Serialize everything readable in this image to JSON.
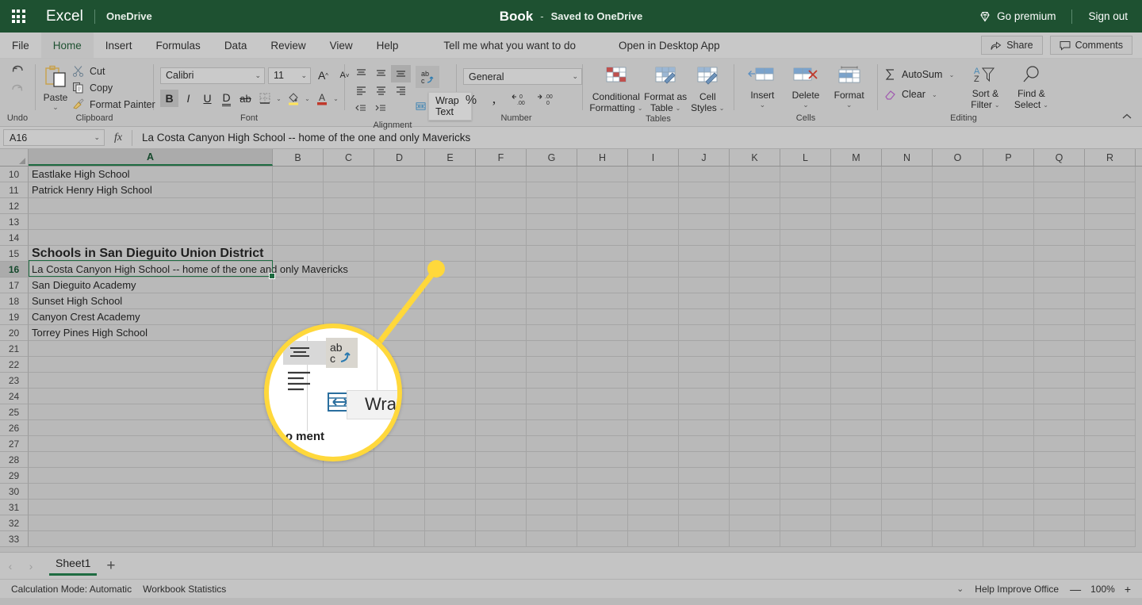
{
  "titlebar": {
    "waffle_icon": "app-launcher-icon",
    "brand": "Excel",
    "location": "OneDrive",
    "doc_name": "Book",
    "doc_dash": "-",
    "doc_state": "Saved to OneDrive",
    "premium_label": "Go premium",
    "premium_icon": "diamond-icon",
    "signout_label": "Sign out",
    "bg_color": "#1e5131"
  },
  "tabs": [
    {
      "label": "File",
      "active": false
    },
    {
      "label": "Home",
      "active": true
    },
    {
      "label": "Insert",
      "active": false
    },
    {
      "label": "Formulas",
      "active": false
    },
    {
      "label": "Data",
      "active": false
    },
    {
      "label": "Review",
      "active": false
    },
    {
      "label": "View",
      "active": false
    },
    {
      "label": "Help",
      "active": false
    },
    {
      "label": "Tell me what you want to do",
      "active": false
    },
    {
      "label": "Open in Desktop App",
      "active": false
    }
  ],
  "tabbar_right": {
    "share_label": "Share",
    "share_icon": "share-icon",
    "comments_label": "Comments",
    "comments_icon": "comment-icon"
  },
  "ribbon": {
    "undo": {
      "group_label": "Undo",
      "undo_icon": "undo-arrow-icon",
      "redo_icon": "redo-arrow-icon"
    },
    "clipboard": {
      "group_label": "Clipboard",
      "paste_label": "Paste",
      "paste_icon": "clipboard-icon",
      "cut_label": "Cut",
      "cut_icon": "scissors-icon",
      "copy_label": "Copy",
      "copy_icon": "copy-icon",
      "format_painter_label": "Format Painter",
      "format_painter_icon": "paintbrush-icon"
    },
    "font": {
      "group_label": "Font",
      "font_family": "Calibri",
      "font_size": "11",
      "grow_font_icon": "grow-font-icon",
      "shrink_font_icon": "shrink-font-icon",
      "bold": "B",
      "italic": "I",
      "underline": "U",
      "double_underline": "D",
      "strikethrough": "ab",
      "borders_icon": "borders-icon",
      "fill_color_icon": "fill-color-icon",
      "font_color_icon": "font-color-icon",
      "bold_active": true
    },
    "alignment": {
      "group_label": "Alignment",
      "top_align_icon": "align-top-icon",
      "middle_align_icon": "align-middle-icon",
      "bottom_align_icon": "align-bottom-icon",
      "align_left_icon": "align-left-icon",
      "align_center_icon": "align-center-icon",
      "align_right_icon": "align-right-icon",
      "decrease_indent_icon": "decrease-indent-icon",
      "increase_indent_icon": "increase-indent-icon",
      "text_orientation_icon": "text-orientation-icon",
      "wrap_text_icon": "wrap-text-icon",
      "wrap_text_tooltip": "Wrap Text"
    },
    "number": {
      "group_label": "Number",
      "format_value": "General",
      "percent_icon": "percent-style-icon",
      "comma_icon": "comma-style-icon",
      "increase_decimal_icon": "increase-decimal-icon",
      "decrease_decimal_icon": "decrease-decimal-icon"
    },
    "tables": {
      "group_label": "Tables",
      "conditional_formatting": "Conditional Formatting",
      "format_as_table": "Format as Table",
      "cell_styles": "Cell Styles"
    },
    "cells": {
      "group_label": "Cells",
      "insert_label": "Insert",
      "delete_label": "Delete",
      "format_label": "Format"
    },
    "editing": {
      "group_label": "Editing",
      "autosum_label": "AutoSum",
      "autosum_icon": "sigma-icon",
      "clear_label": "Clear",
      "clear_icon": "eraser-icon",
      "sort_filter_label": "Sort & Filter",
      "sort_filter_icon": "sort-filter-icon",
      "find_select_label": "Find & Select",
      "find_select_icon": "magnifier-icon"
    },
    "collapse_icon": "chevron-up-icon"
  },
  "formula_bar": {
    "name_box_value": "A16",
    "name_box_caret": "chevron-down-icon",
    "fx_label": "fx",
    "formula_value": "La Costa Canyon High School -- home of the one and only Mavericks"
  },
  "grid": {
    "columns": [
      "A",
      "B",
      "C",
      "D",
      "E",
      "F",
      "G",
      "H",
      "I",
      "J",
      "K",
      "L",
      "M",
      "N",
      "O",
      "P",
      "Q",
      "R"
    ],
    "selected_column": "A",
    "selected_row": 16,
    "selected_cell": "A16",
    "rows": [
      {
        "num": 10,
        "a": "Eastlake High School",
        "style": "normal"
      },
      {
        "num": 11,
        "a": "Patrick Henry High School",
        "style": "normal"
      },
      {
        "num": 12,
        "a": "",
        "style": "normal"
      },
      {
        "num": 13,
        "a": "",
        "style": "normal"
      },
      {
        "num": 14,
        "a": "",
        "style": "normal"
      },
      {
        "num": 15,
        "a": "Schools in San Dieguito Union District",
        "style": "heading"
      },
      {
        "num": 16,
        "a": "La Costa Canyon High School -- home of the one and only Mavericks",
        "style": "selected"
      },
      {
        "num": 17,
        "a": "San Dieguito Academy",
        "style": "normal"
      },
      {
        "num": 18,
        "a": "Sunset High School",
        "style": "normal"
      },
      {
        "num": 19,
        "a": "Canyon Crest Academy",
        "style": "normal"
      },
      {
        "num": 20,
        "a": "Torrey Pines High School",
        "style": "normal"
      },
      {
        "num": 21,
        "a": "",
        "style": "normal"
      },
      {
        "num": 22,
        "a": "",
        "style": "normal"
      },
      {
        "num": 23,
        "a": "",
        "style": "normal"
      },
      {
        "num": 24,
        "a": "",
        "style": "normal"
      },
      {
        "num": 25,
        "a": "",
        "style": "normal"
      },
      {
        "num": 26,
        "a": "",
        "style": "normal"
      },
      {
        "num": 27,
        "a": "",
        "style": "normal"
      },
      {
        "num": 28,
        "a": "",
        "style": "normal"
      },
      {
        "num": 29,
        "a": "",
        "style": "normal"
      },
      {
        "num": 30,
        "a": "",
        "style": "normal"
      },
      {
        "num": 31,
        "a": "",
        "style": "normal"
      },
      {
        "num": 32,
        "a": "",
        "style": "normal"
      },
      {
        "num": 33,
        "a": "",
        "style": "normal"
      }
    ]
  },
  "callout": {
    "highlight_color": "#ffd83b",
    "magnified_tooltip": "Wrap",
    "magnified_overflow_text": "and o  ment"
  },
  "sheetbar": {
    "prev_icon": "chevron-left-icon",
    "next_icon": "chevron-right-icon",
    "sheet_name": "Sheet1",
    "add_sheet_icon": "plus-icon"
  },
  "statusbar": {
    "calculation_mode": "Calculation Mode: Automatic",
    "workbook_statistics": "Workbook Statistics",
    "more_icon": "chevron-down-icon",
    "help_improve": "Help Improve Office",
    "zoom_out_icon": "minus-icon",
    "zoom_level": "100%",
    "zoom_in_icon": "plus-icon"
  }
}
